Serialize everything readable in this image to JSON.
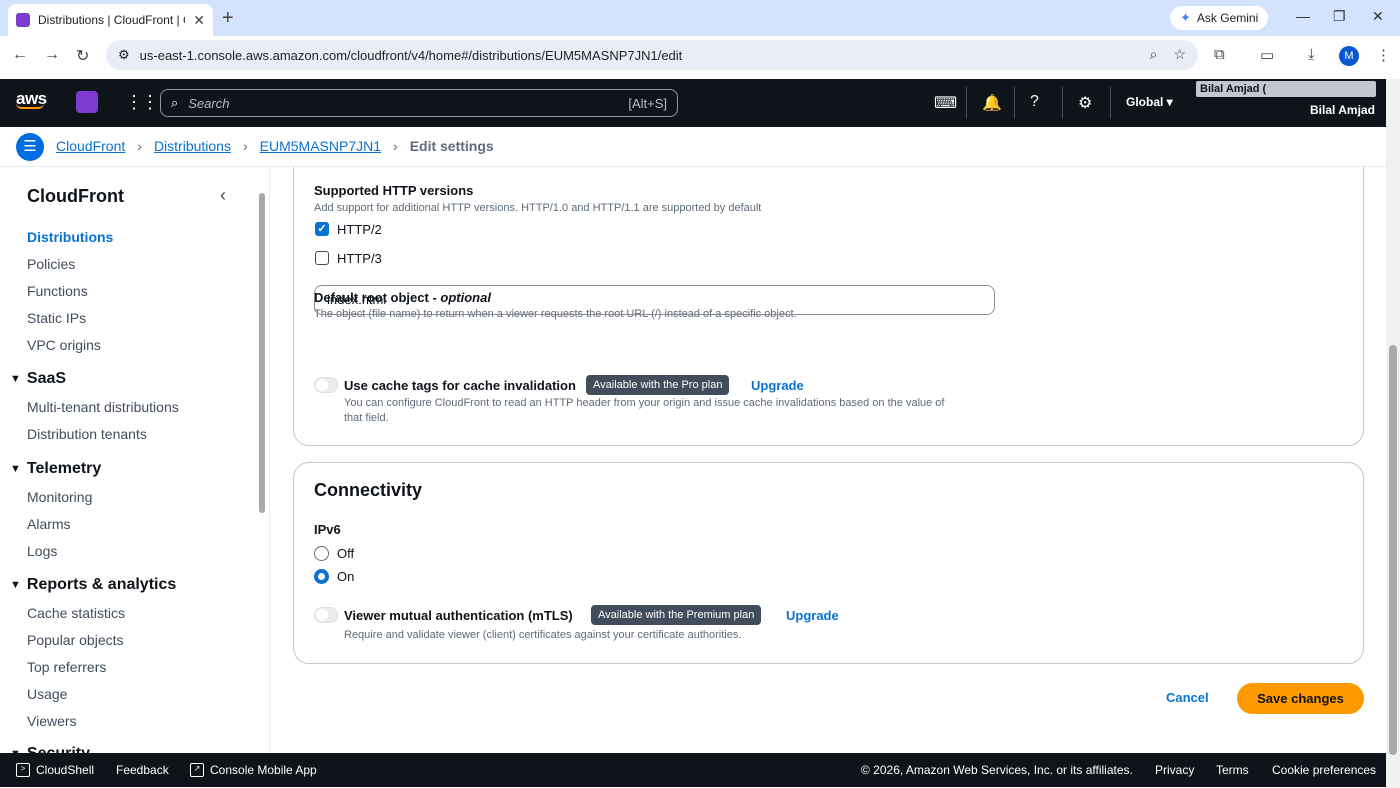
{
  "browser": {
    "tab_title": "Distributions | CloudFront | Glo",
    "url": "us-east-1.console.aws.amazon.com/cloudfront/v4/home#/distributions/EUM5MASNP7JN1/edit",
    "gemini_label": "Ask Gemini",
    "profile_initial": "M"
  },
  "header": {
    "logo": "aws",
    "search_placeholder": "Search",
    "search_shortcut": "[Alt+S]",
    "region": "Global",
    "account_top": "Bilal Amjad (",
    "account_name": "Bilal Amjad"
  },
  "breadcrumb": {
    "items": [
      "CloudFront",
      "Distributions",
      "EUM5MASNP7JN1"
    ],
    "current": "Edit settings"
  },
  "sidenav": {
    "title": "CloudFront",
    "top_items": [
      "Distributions",
      "Policies",
      "Functions",
      "Static IPs",
      "VPC origins"
    ],
    "sections": [
      {
        "title": "SaaS",
        "items": [
          "Multi-tenant distributions",
          "Distribution tenants"
        ]
      },
      {
        "title": "Telemetry",
        "items": [
          "Monitoring",
          "Alarms",
          "Logs"
        ]
      },
      {
        "title": "Reports & analytics",
        "items": [
          "Cache statistics",
          "Popular objects",
          "Top referrers",
          "Usage",
          "Viewers"
        ]
      },
      {
        "title": "Security",
        "items": []
      }
    ]
  },
  "settings": {
    "http_versions": {
      "label": "Supported HTTP versions",
      "description": "Add support for additional HTTP versions. HTTP/1.0 and HTTP/1.1 are supported by default",
      "options": [
        {
          "label": "HTTP/2",
          "checked": true
        },
        {
          "label": "HTTP/3",
          "checked": false
        }
      ]
    },
    "root_object": {
      "label": "Default root object - ",
      "label_optional": "optional",
      "description": "The object (file name) to return when a viewer requests the root URL (/) instead of a specific object.",
      "value": "index.html"
    },
    "cache_tags": {
      "label": "Use cache tags for cache invalidation",
      "badge": "Available with the Pro plan",
      "upgrade": "Upgrade",
      "description_line1": "You can configure CloudFront to read an HTTP header from your origin and issue cache invalidations based on the value of",
      "description_line2": "that field."
    }
  },
  "connectivity": {
    "title": "Connectivity",
    "ipv6_label": "IPv6",
    "ipv6_options": [
      {
        "label": "Off",
        "selected": false
      },
      {
        "label": "On",
        "selected": true
      }
    ],
    "mtls": {
      "label": "Viewer mutual authentication (mTLS)",
      "badge": "Available with the Premium plan",
      "upgrade": "Upgrade",
      "description": "Require and validate viewer (client) certificates against your certificate authorities."
    }
  },
  "actions": {
    "cancel": "Cancel",
    "save": "Save changes"
  },
  "footer": {
    "cloudshell": "CloudShell",
    "feedback": "Feedback",
    "mobile_app": "Console Mobile App",
    "copyright": "© 2026, Amazon Web Services, Inc. or its affiliates.",
    "privacy": "Privacy",
    "terms": "Terms",
    "cookies": "Cookie preferences"
  },
  "colors": {
    "accent": "#0972d3",
    "save_button": "#ff9900",
    "header_bg": "#0f141a"
  }
}
